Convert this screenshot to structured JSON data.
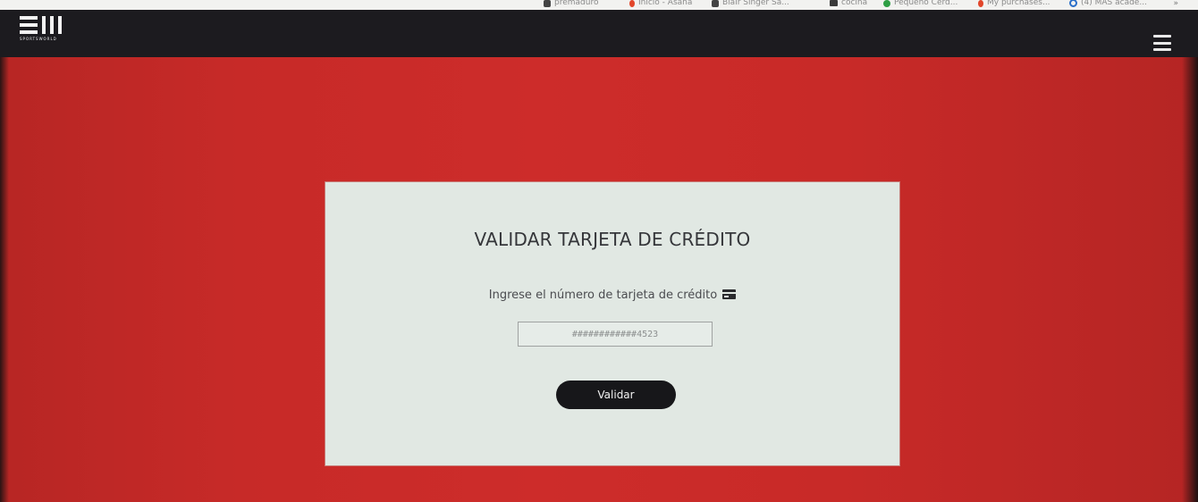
{
  "bookmarks": [
    {
      "label": "premaduro",
      "icon": "bookmark-icon"
    },
    {
      "label": "Inicio - Asana",
      "icon": "asana-icon"
    },
    {
      "label": "Blair Singer Sa...",
      "icon": "link-icon"
    },
    {
      "label": "cocina",
      "icon": "folder-icon"
    },
    {
      "label": "Pequeño Cerd...",
      "icon": "green-circle-icon"
    },
    {
      "label": "My purchases...",
      "icon": "orange-icon"
    },
    {
      "label": "(4) MAS acade...",
      "icon": "blue-circle-icon"
    }
  ],
  "bookmarks_more": "»",
  "header": {
    "logo_sub": "SPORTSWORLD",
    "menu_icon": "hamburger-menu-icon"
  },
  "card": {
    "title": "VALIDAR TARJETA DE CRÉDITO",
    "prompt": "Ingrese el número de tarjeta de crédito",
    "prompt_icon": "credit-card-icon",
    "input_placeholder": "############4523",
    "button_label": "Validar"
  },
  "colors": {
    "background_red": "#c82a28",
    "header_dark": "#1c1b1f",
    "card_bg": "#e1e8e3",
    "button_bg": "#17171a"
  }
}
